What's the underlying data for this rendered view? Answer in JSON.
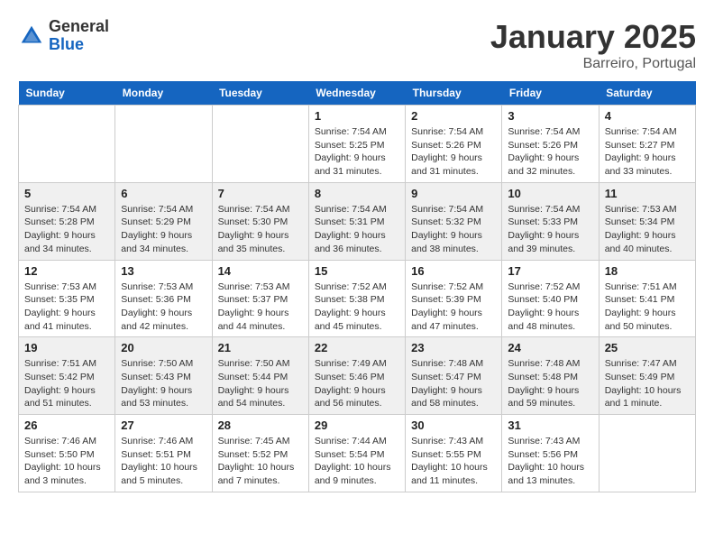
{
  "logo": {
    "general": "General",
    "blue": "Blue"
  },
  "title": "January 2025",
  "location": "Barreiro, Portugal",
  "weekdays": [
    "Sunday",
    "Monday",
    "Tuesday",
    "Wednesday",
    "Thursday",
    "Friday",
    "Saturday"
  ],
  "weeks": [
    [
      {
        "day": "",
        "detail": ""
      },
      {
        "day": "",
        "detail": ""
      },
      {
        "day": "",
        "detail": ""
      },
      {
        "day": "1",
        "detail": "Sunrise: 7:54 AM\nSunset: 5:25 PM\nDaylight: 9 hours\nand 31 minutes."
      },
      {
        "day": "2",
        "detail": "Sunrise: 7:54 AM\nSunset: 5:26 PM\nDaylight: 9 hours\nand 31 minutes."
      },
      {
        "day": "3",
        "detail": "Sunrise: 7:54 AM\nSunset: 5:26 PM\nDaylight: 9 hours\nand 32 minutes."
      },
      {
        "day": "4",
        "detail": "Sunrise: 7:54 AM\nSunset: 5:27 PM\nDaylight: 9 hours\nand 33 minutes."
      }
    ],
    [
      {
        "day": "5",
        "detail": "Sunrise: 7:54 AM\nSunset: 5:28 PM\nDaylight: 9 hours\nand 34 minutes."
      },
      {
        "day": "6",
        "detail": "Sunrise: 7:54 AM\nSunset: 5:29 PM\nDaylight: 9 hours\nand 34 minutes."
      },
      {
        "day": "7",
        "detail": "Sunrise: 7:54 AM\nSunset: 5:30 PM\nDaylight: 9 hours\nand 35 minutes."
      },
      {
        "day": "8",
        "detail": "Sunrise: 7:54 AM\nSunset: 5:31 PM\nDaylight: 9 hours\nand 36 minutes."
      },
      {
        "day": "9",
        "detail": "Sunrise: 7:54 AM\nSunset: 5:32 PM\nDaylight: 9 hours\nand 38 minutes."
      },
      {
        "day": "10",
        "detail": "Sunrise: 7:54 AM\nSunset: 5:33 PM\nDaylight: 9 hours\nand 39 minutes."
      },
      {
        "day": "11",
        "detail": "Sunrise: 7:53 AM\nSunset: 5:34 PM\nDaylight: 9 hours\nand 40 minutes."
      }
    ],
    [
      {
        "day": "12",
        "detail": "Sunrise: 7:53 AM\nSunset: 5:35 PM\nDaylight: 9 hours\nand 41 minutes."
      },
      {
        "day": "13",
        "detail": "Sunrise: 7:53 AM\nSunset: 5:36 PM\nDaylight: 9 hours\nand 42 minutes."
      },
      {
        "day": "14",
        "detail": "Sunrise: 7:53 AM\nSunset: 5:37 PM\nDaylight: 9 hours\nand 44 minutes."
      },
      {
        "day": "15",
        "detail": "Sunrise: 7:52 AM\nSunset: 5:38 PM\nDaylight: 9 hours\nand 45 minutes."
      },
      {
        "day": "16",
        "detail": "Sunrise: 7:52 AM\nSunset: 5:39 PM\nDaylight: 9 hours\nand 47 minutes."
      },
      {
        "day": "17",
        "detail": "Sunrise: 7:52 AM\nSunset: 5:40 PM\nDaylight: 9 hours\nand 48 minutes."
      },
      {
        "day": "18",
        "detail": "Sunrise: 7:51 AM\nSunset: 5:41 PM\nDaylight: 9 hours\nand 50 minutes."
      }
    ],
    [
      {
        "day": "19",
        "detail": "Sunrise: 7:51 AM\nSunset: 5:42 PM\nDaylight: 9 hours\nand 51 minutes."
      },
      {
        "day": "20",
        "detail": "Sunrise: 7:50 AM\nSunset: 5:43 PM\nDaylight: 9 hours\nand 53 minutes."
      },
      {
        "day": "21",
        "detail": "Sunrise: 7:50 AM\nSunset: 5:44 PM\nDaylight: 9 hours\nand 54 minutes."
      },
      {
        "day": "22",
        "detail": "Sunrise: 7:49 AM\nSunset: 5:46 PM\nDaylight: 9 hours\nand 56 minutes."
      },
      {
        "day": "23",
        "detail": "Sunrise: 7:48 AM\nSunset: 5:47 PM\nDaylight: 9 hours\nand 58 minutes."
      },
      {
        "day": "24",
        "detail": "Sunrise: 7:48 AM\nSunset: 5:48 PM\nDaylight: 9 hours\nand 59 minutes."
      },
      {
        "day": "25",
        "detail": "Sunrise: 7:47 AM\nSunset: 5:49 PM\nDaylight: 10 hours\nand 1 minute."
      }
    ],
    [
      {
        "day": "26",
        "detail": "Sunrise: 7:46 AM\nSunset: 5:50 PM\nDaylight: 10 hours\nand 3 minutes."
      },
      {
        "day": "27",
        "detail": "Sunrise: 7:46 AM\nSunset: 5:51 PM\nDaylight: 10 hours\nand 5 minutes."
      },
      {
        "day": "28",
        "detail": "Sunrise: 7:45 AM\nSunset: 5:52 PM\nDaylight: 10 hours\nand 7 minutes."
      },
      {
        "day": "29",
        "detail": "Sunrise: 7:44 AM\nSunset: 5:54 PM\nDaylight: 10 hours\nand 9 minutes."
      },
      {
        "day": "30",
        "detail": "Sunrise: 7:43 AM\nSunset: 5:55 PM\nDaylight: 10 hours\nand 11 minutes."
      },
      {
        "day": "31",
        "detail": "Sunrise: 7:43 AM\nSunset: 5:56 PM\nDaylight: 10 hours\nand 13 minutes."
      },
      {
        "day": "",
        "detail": ""
      }
    ]
  ]
}
